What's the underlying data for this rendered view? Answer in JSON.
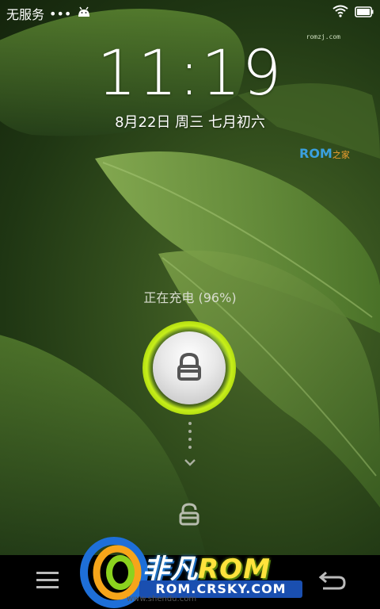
{
  "status_bar": {
    "carrier": "无服务",
    "dots": "•••"
  },
  "watermark_top": "romzj.com",
  "clock": {
    "time": "11:19"
  },
  "date": {
    "text": "8月22日 周三   七月初六"
  },
  "rom_mark": {
    "main": "ROM",
    "sub": "之家"
  },
  "charging": {
    "text": "正在充电 (96%)"
  },
  "brand": {
    "title_cn": "非凡",
    "title_rom": "ROM",
    "url": "ROM.CRSKY.COM",
    "faint": "www.shendu.com"
  },
  "colors": {
    "accent_ring": "#c7ef1a",
    "url_bar": "#1a4fb0"
  },
  "icons": [
    "android-icon",
    "wifi-icon",
    "battery-icon",
    "lock-icon",
    "chevron-down-icon",
    "unlock-icon",
    "menu-icon",
    "back-icon"
  ]
}
